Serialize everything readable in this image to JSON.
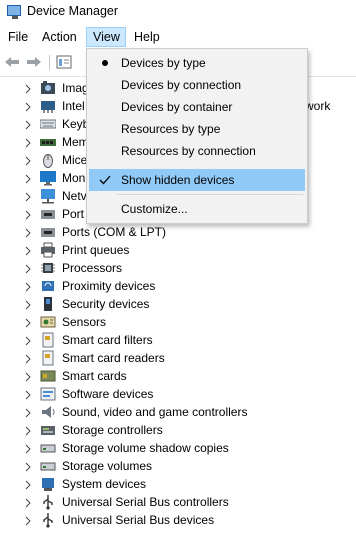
{
  "window": {
    "title": "Device Manager"
  },
  "menu": {
    "file": "File",
    "action": "Action",
    "view": "View",
    "help": "Help"
  },
  "tree": {
    "items": [
      {
        "label": "Imag",
        "icon": "imaging-icon"
      },
      {
        "label": "Intel",
        "icon": "network-adapter-icon"
      },
      {
        "label": "Keyb",
        "icon": "keyboard-icon"
      },
      {
        "label": "Mem",
        "icon": "memory-icon"
      },
      {
        "label": "Mice",
        "icon": "mouse-icon"
      },
      {
        "label": "Mon",
        "icon": "monitor-icon"
      },
      {
        "label": "Netv",
        "icon": "network-icon"
      },
      {
        "label": "Port",
        "icon": "port-icon"
      },
      {
        "label": "Ports (COM & LPT)",
        "icon": "port-icon"
      },
      {
        "label": "Print queues",
        "icon": "printer-icon"
      },
      {
        "label": "Processors",
        "icon": "processor-icon"
      },
      {
        "label": "Proximity devices",
        "icon": "proximity-icon"
      },
      {
        "label": "Security devices",
        "icon": "security-icon"
      },
      {
        "label": "Sensors",
        "icon": "sensor-icon"
      },
      {
        "label": "Smart card filters",
        "icon": "smart-card-filter-icon"
      },
      {
        "label": "Smart card readers",
        "icon": "smart-card-reader-icon"
      },
      {
        "label": "Smart cards",
        "icon": "smart-card-icon"
      },
      {
        "label": "Software devices",
        "icon": "software-device-icon"
      },
      {
        "label": "Sound, video and game controllers",
        "icon": "speaker-icon"
      },
      {
        "label": "Storage controllers",
        "icon": "storage-controller-icon"
      },
      {
        "label": "Storage volume shadow copies",
        "icon": "drive-icon"
      },
      {
        "label": "Storage volumes",
        "icon": "drive-icon"
      },
      {
        "label": "System devices",
        "icon": "system-device-icon"
      },
      {
        "label": "Universal Serial Bus controllers",
        "icon": "usb-icon"
      },
      {
        "label": "Universal Serial Bus devices",
        "icon": "usb-icon"
      }
    ],
    "trailing_text": "work"
  },
  "view_menu": {
    "devices_by_type": "Devices by type",
    "devices_by_connection": "Devices by connection",
    "devices_by_container": "Devices by container",
    "resources_by_type": "Resources by type",
    "resources_by_connection": "Resources by connection",
    "show_hidden_devices": "Show hidden devices",
    "customize": "Customize..."
  },
  "colors": {
    "menu_active_bg": "#cce8ff",
    "dropdown_bg": "#f2f2f2",
    "highlight": "#91c9f7"
  }
}
